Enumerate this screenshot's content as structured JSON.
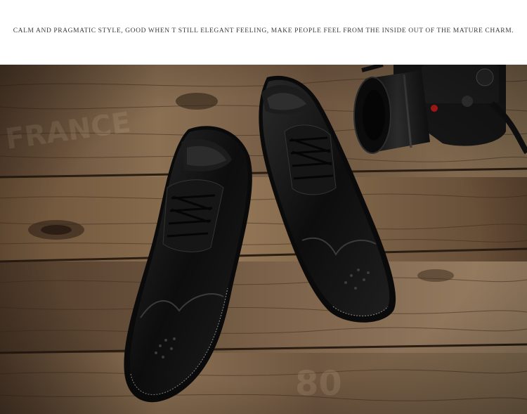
{
  "header": {
    "tagline": "CALM AND PRAGMATIC STYLE, GOOD WHEN T STILL ELEGANT FEELING, MAKE PEOPLE FEEL FROM THE INSIDE OUT OF THE MATURE CHARM."
  },
  "photo": {
    "subject": "pair of black leather brogue oxford shoes with a camera on a rustic wood surface",
    "colors": {
      "wood_light": "#8a7155",
      "wood_dark": "#3b2c1f",
      "leather": "#141414",
      "camera": "#1a1a1a"
    }
  }
}
